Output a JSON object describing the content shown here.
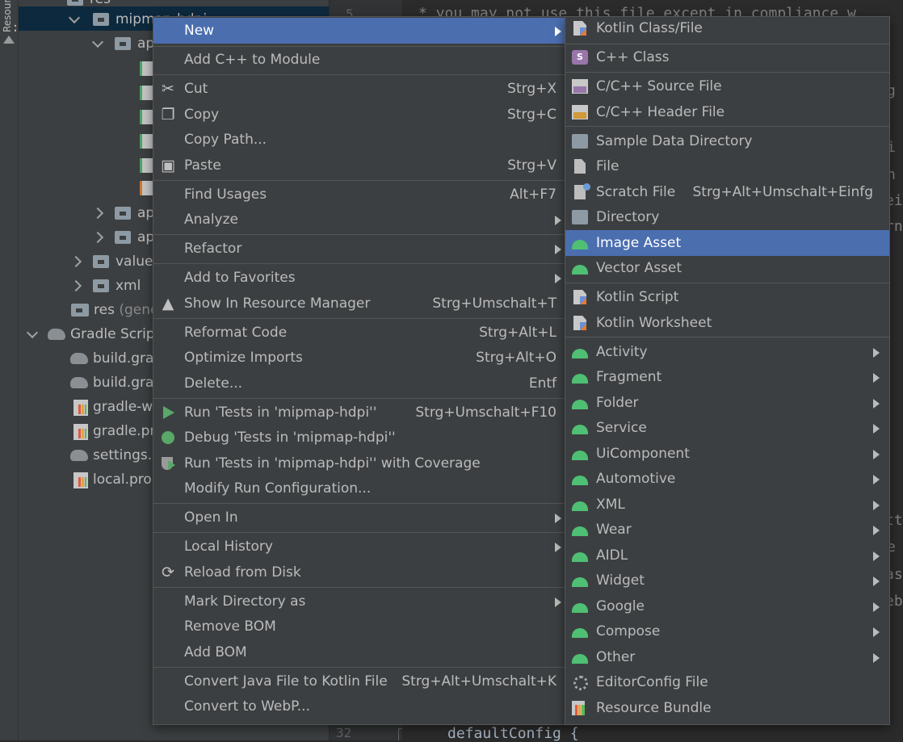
{
  "sidebar": {
    "tool_window_label": "Resource Manager"
  },
  "tree": {
    "rows": [
      {
        "label": "res"
      },
      {
        "label": "mipmap-hdpi"
      },
      {
        "label": "ap"
      },
      {
        "label": "ap"
      },
      {
        "label": "ap"
      },
      {
        "label": "values"
      },
      {
        "label": "xml"
      },
      {
        "label": "res",
        "hint": "(gene"
      },
      {
        "label": "Gradle Script"
      },
      {
        "label": "build.grac"
      },
      {
        "label": "build.grac"
      },
      {
        "label": "gradle-wr"
      },
      {
        "label": "gradle.pro"
      },
      {
        "label": "settings.g"
      },
      {
        "label": "local.prop"
      }
    ]
  },
  "editor": {
    "line_numbers": {
      "top": "5",
      "bottom": "32"
    },
    "code_top": "* you may not use this file except in compliance w",
    "code_bottom": "defaultConfig {",
    "fragments": [
      "g",
      "i",
      "n",
      "ei",
      "rn",
      "tt",
      "e",
      "as",
      "eb"
    ]
  },
  "context_menu": {
    "items": [
      {
        "label": "New",
        "has_submenu": true,
        "selected": true
      },
      {
        "label": "Add C++ to Module"
      },
      {
        "label": "Cut",
        "shortcut": "Strg+X",
        "icon": "scissors-icon"
      },
      {
        "label": "Copy",
        "shortcut": "Strg+C",
        "icon": "copy-icon"
      },
      {
        "label": "Copy Path..."
      },
      {
        "label": "Paste",
        "shortcut": "Strg+V",
        "icon": "paste-icon"
      },
      {
        "label": "Find Usages",
        "shortcut": "Alt+F7"
      },
      {
        "label": "Analyze",
        "has_submenu": true
      },
      {
        "label": "Refactor",
        "has_submenu": true
      },
      {
        "label": "Add to Favorites",
        "has_submenu": true
      },
      {
        "label": "Show In Resource Manager",
        "shortcut": "Strg+Umschalt+T",
        "icon": "resource-manager-icon"
      },
      {
        "label": "Reformat Code",
        "shortcut": "Strg+Alt+L"
      },
      {
        "label": "Optimize Imports",
        "shortcut": "Strg+Alt+O"
      },
      {
        "label": "Delete...",
        "shortcut": "Entf"
      },
      {
        "label": "Run 'Tests in 'mipmap-hdpi''",
        "shortcut": "Strg+Umschalt+F10",
        "icon": "run-icon"
      },
      {
        "label": "Debug 'Tests in 'mipmap-hdpi''",
        "icon": "debug-icon"
      },
      {
        "label": "Run 'Tests in 'mipmap-hdpi'' with Coverage",
        "icon": "coverage-icon"
      },
      {
        "label": "Modify Run Configuration..."
      },
      {
        "label": "Open In",
        "has_submenu": true
      },
      {
        "label": "Local History",
        "has_submenu": true
      },
      {
        "label": "Reload from Disk",
        "icon": "reload-icon"
      },
      {
        "label": "Mark Directory as",
        "has_submenu": true
      },
      {
        "label": "Remove BOM"
      },
      {
        "label": "Add BOM"
      },
      {
        "label": "Convert Java File to Kotlin File",
        "shortcut": "Strg+Alt+Umschalt+K"
      },
      {
        "label": "Convert to WebP..."
      }
    ]
  },
  "new_submenu": {
    "items": [
      {
        "label": "Kotlin Class/File",
        "icon": "kotlin-file-icon"
      },
      {
        "label": "C++ Class",
        "icon": "cpp-class-icon",
        "icon_text": "S"
      },
      {
        "label": "C/C++ Source File",
        "icon": "cpp-source-icon"
      },
      {
        "label": "C/C++ Header File",
        "icon": "cpp-header-icon"
      },
      {
        "label": "Sample Data Directory",
        "icon": "folder-icon"
      },
      {
        "label": "File",
        "icon": "file-icon"
      },
      {
        "label": "Scratch File",
        "shortcut": "Strg+Alt+Umschalt+Einfg",
        "icon": "scratch-file-icon"
      },
      {
        "label": "Directory",
        "icon": "folder-icon"
      },
      {
        "label": "Image Asset",
        "icon": "android-icon",
        "selected": true
      },
      {
        "label": "Vector Asset",
        "icon": "android-icon"
      },
      {
        "label": "Kotlin Script",
        "icon": "kotlin-script-icon"
      },
      {
        "label": "Kotlin Worksheet",
        "icon": "kotlin-worksheet-icon"
      },
      {
        "label": "Activity",
        "icon": "android-icon",
        "has_submenu": true
      },
      {
        "label": "Fragment",
        "icon": "android-icon",
        "has_submenu": true
      },
      {
        "label": "Folder",
        "icon": "android-icon",
        "has_submenu": true
      },
      {
        "label": "Service",
        "icon": "android-icon",
        "has_submenu": true
      },
      {
        "label": "UiComponent",
        "icon": "android-icon",
        "has_submenu": true
      },
      {
        "label": "Automotive",
        "icon": "android-icon",
        "has_submenu": true
      },
      {
        "label": "XML",
        "icon": "android-icon",
        "has_submenu": true
      },
      {
        "label": "Wear",
        "icon": "android-icon",
        "has_submenu": true
      },
      {
        "label": "AIDL",
        "icon": "android-icon",
        "has_submenu": true
      },
      {
        "label": "Widget",
        "icon": "android-icon",
        "has_submenu": true
      },
      {
        "label": "Google",
        "icon": "android-icon",
        "has_submenu": true
      },
      {
        "label": "Compose",
        "icon": "android-icon",
        "has_submenu": true
      },
      {
        "label": "Other",
        "icon": "android-icon",
        "has_submenu": true
      },
      {
        "label": "EditorConfig File",
        "icon": "gear-icon"
      },
      {
        "label": "Resource Bundle",
        "icon": "resource-bundle-icon"
      }
    ]
  },
  "colors": {
    "menu_bg": "#3c3f41",
    "selection": "#4b6eaf",
    "tree_selection": "#0d293e",
    "editor_bg": "#2b2b2b",
    "android_green": "#4fbf74"
  }
}
